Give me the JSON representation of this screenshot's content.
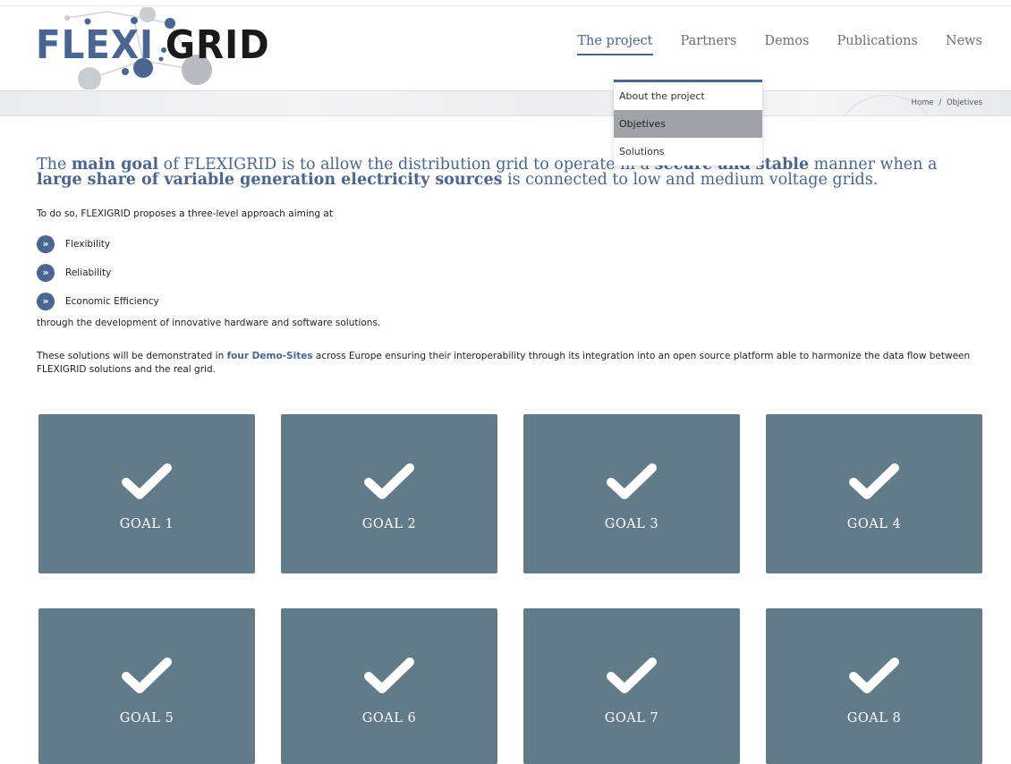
{
  "logo": {
    "part1": "FLEXI",
    "part2": "GRID",
    "brand_color": "#4a6591",
    "dark_color": "#1a1a1a"
  },
  "nav": {
    "items": [
      {
        "label": "The project",
        "active": true
      },
      {
        "label": "Partners"
      },
      {
        "label": "Demos"
      },
      {
        "label": "Publications"
      },
      {
        "label": "News"
      }
    ]
  },
  "dropdown": {
    "items": [
      {
        "label": "About the project"
      },
      {
        "label": "Objetives",
        "selected": true
      },
      {
        "label": "Solutions"
      }
    ]
  },
  "breadcrumb": {
    "home": "Home",
    "separator": "/",
    "current": "Objetives"
  },
  "intro": {
    "t1": "The ",
    "b1": "main goal",
    "t2": " of FLEXIGRID is to allow the distribution grid to operate in a ",
    "b2": "secure and stable",
    "t3": " manner when a ",
    "b3": "large share of variable generation electricity sources",
    "t4": " is connected to low and medium voltage grids."
  },
  "para1": "To do so, FLEXIGRID proposes a three-level approach aiming at",
  "bullets": [
    {
      "icon": "double-chevron-right-icon",
      "text": "Flexibility"
    },
    {
      "icon": "double-chevron-right-icon",
      "text": "Reliability"
    },
    {
      "icon": "double-chevron-right-icon",
      "text": "Economic Efficiency"
    }
  ],
  "para2": "through the development of innovative hardware and software solutions.",
  "para3": {
    "t1": "These solutions will be demonstrated in ",
    "b1": "four Demo-Sites",
    "t2": " across Europe ensuring their interoperability through its integration into an open source platform able to harmonize the data flow between FLEXIGRID solutions and the real grid."
  },
  "goals": [
    {
      "label": "GOAL 1",
      "icon": "checkmark-icon"
    },
    {
      "label": "GOAL 2",
      "icon": "checkmark-icon"
    },
    {
      "label": "GOAL 3",
      "icon": "checkmark-icon"
    },
    {
      "label": "GOAL 4",
      "icon": "checkmark-icon"
    },
    {
      "label": "GOAL 5",
      "icon": "checkmark-icon"
    },
    {
      "label": "GOAL 6",
      "icon": "checkmark-icon"
    },
    {
      "label": "GOAL 7",
      "icon": "checkmark-icon"
    },
    {
      "label": "GOAL 8",
      "icon": "checkmark-icon"
    }
  ],
  "colors": {
    "accent": "#4a6591",
    "tile": "#627b89",
    "dropdown_selected": "#9fa2a6"
  }
}
